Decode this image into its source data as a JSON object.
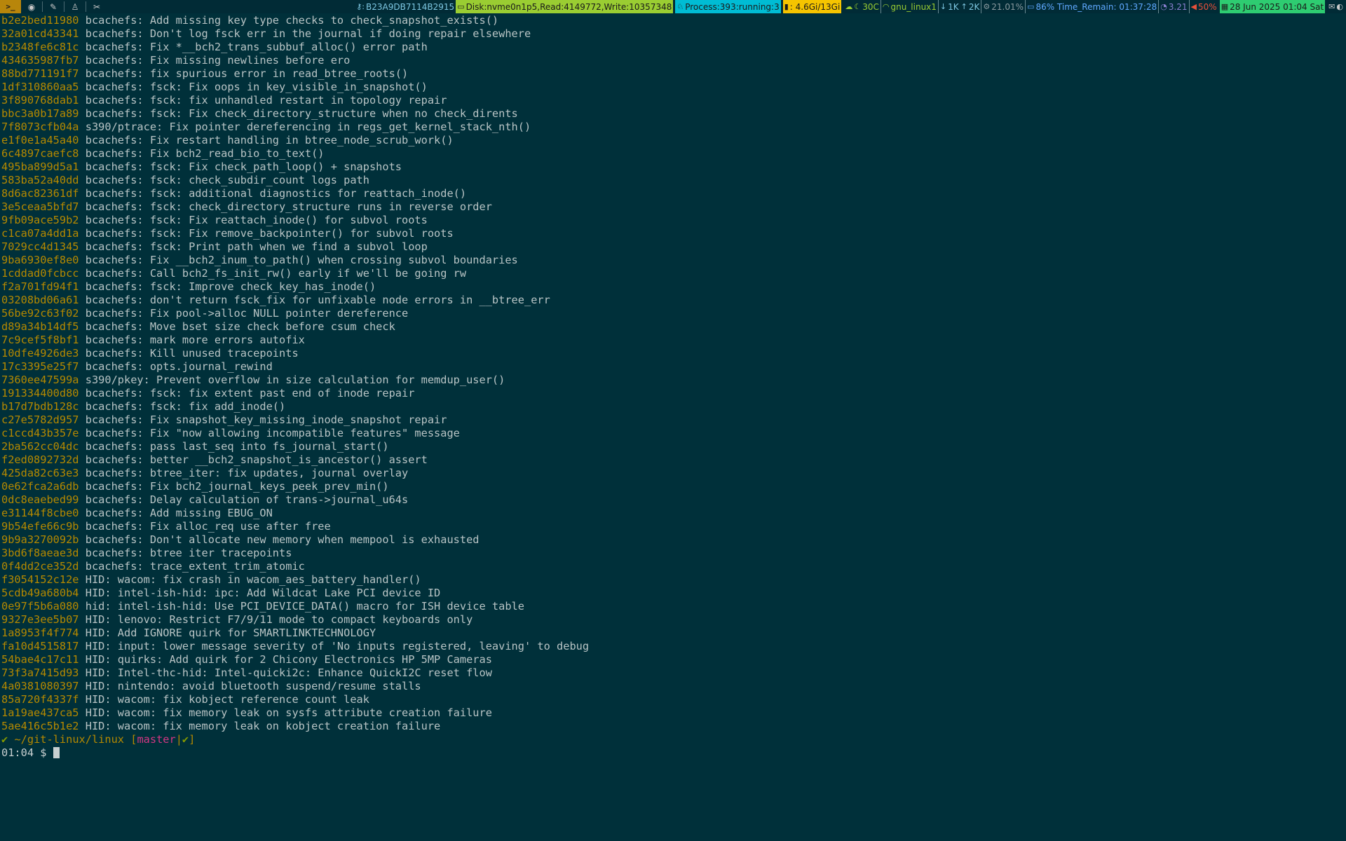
{
  "topbar": {
    "terminal_icon": ">_",
    "key": "B23A9DB7114B2915",
    "disk": "Disk:nvme0n1p5,Read:4149772,Write:10357348",
    "process": "Process:393:running:3",
    "memory": ": 4.6Gi/13Gi",
    "temp": "30C",
    "wifi": "gnu_linux1",
    "down": "1K",
    "up": "2K",
    "cpu": "21.01%",
    "battery": "86% Time_Remain: 01:37:28",
    "load": "3.21",
    "volume": "50%",
    "datetime": "28 Jun 2025 01:04 Sat",
    "colors": {
      "disk_bg": "#9acd32",
      "process_bg": "#00bcd4",
      "memory_bg": "#f5c400",
      "datetime_bg": "#2ecc71"
    }
  },
  "log": [
    {
      "hash": "b2e2bed11980",
      "msg": "bcachefs: Add missing key type checks to check_snapshot_exists()"
    },
    {
      "hash": "32a01cd43341",
      "msg": "bcachefs: Don't log fsck err in the journal if doing repair elsewhere"
    },
    {
      "hash": "b2348fe6c81c",
      "msg": "bcachefs: Fix *__bch2_trans_subbuf_alloc() error path"
    },
    {
      "hash": "434635987fb7",
      "msg": "bcachefs: Fix missing newlines before ero"
    },
    {
      "hash": "88bd771191f7",
      "msg": "bcachefs: fix spurious error in read_btree_roots()"
    },
    {
      "hash": "1df310860aa5",
      "msg": "bcachefs: fsck: Fix oops in key_visible_in_snapshot()"
    },
    {
      "hash": "3f890768dab1",
      "msg": "bcachefs: fsck: fix unhandled restart in topology repair"
    },
    {
      "hash": "bbc3a0b17a89",
      "msg": "bcachefs: fsck: Fix check_directory_structure when no check_dirents"
    },
    {
      "hash": "7f8073cfb04a",
      "msg": "s390/ptrace: Fix pointer dereferencing in regs_get_kernel_stack_nth()"
    },
    {
      "hash": "e1f0e1a45a40",
      "msg": "bcachefs: Fix restart handling in btree_node_scrub_work()"
    },
    {
      "hash": "6c4897caefc8",
      "msg": "bcachefs: Fix bch2_read_bio_to_text()"
    },
    {
      "hash": "495ba899d5a1",
      "msg": "bcachefs: fsck: Fix check_path_loop() + snapshots"
    },
    {
      "hash": "583ba52a40dd",
      "msg": "bcachefs: fsck: check_subdir_count logs path"
    },
    {
      "hash": "8d6ac82361df",
      "msg": "bcachefs: fsck: additional diagnostics for reattach_inode()"
    },
    {
      "hash": "3e5ceaa5bfd7",
      "msg": "bcachefs: fsck: check_directory_structure runs in reverse order"
    },
    {
      "hash": "9fb09ace59b2",
      "msg": "bcachefs: fsck: Fix reattach_inode() for subvol roots"
    },
    {
      "hash": "c1ca07a4dd1a",
      "msg": "bcachefs: fsck: Fix remove_backpointer() for subvol roots"
    },
    {
      "hash": "7029cc4d1345",
      "msg": "bcachefs: fsck: Print path when we find a subvol loop"
    },
    {
      "hash": "9ba6930ef8e0",
      "msg": "bcachefs: Fix __bch2_inum_to_path() when crossing subvol boundaries"
    },
    {
      "hash": "1cddad0fcbcc",
      "msg": "bcachefs: Call bch2_fs_init_rw() early if we'll be going rw"
    },
    {
      "hash": "f2a701fd94f1",
      "msg": "bcachefs: fsck: Improve check_key_has_inode()"
    },
    {
      "hash": "03208bd06a61",
      "msg": "bcachefs: don't return fsck_fix for unfixable node errors in __btree_err"
    },
    {
      "hash": "56be92c63f02",
      "msg": "bcachefs: Fix pool->alloc NULL pointer dereference"
    },
    {
      "hash": "d89a34b14df5",
      "msg": "bcachefs: Move bset size check before csum check"
    },
    {
      "hash": "7c9cef5f8bf1",
      "msg": "bcachefs: mark more errors autofix"
    },
    {
      "hash": "10dfe4926de3",
      "msg": "bcachefs: Kill unused tracepoints"
    },
    {
      "hash": "17c3395e25f7",
      "msg": "bcachefs: opts.journal_rewind"
    },
    {
      "hash": "7360ee47599a",
      "msg": "s390/pkey: Prevent overflow in size calculation for memdup_user()"
    },
    {
      "hash": "191334400d80",
      "msg": "bcachefs: fsck: fix extent past end of inode repair"
    },
    {
      "hash": "b17d7bdb128c",
      "msg": "bcachefs: fsck: fix add_inode()"
    },
    {
      "hash": "c27e5782d957",
      "msg": "bcachefs: Fix snapshot_key_missing_inode_snapshot repair"
    },
    {
      "hash": "c1ccd43b357e",
      "msg": "bcachefs: Fix \"now allowing incompatible features\" message"
    },
    {
      "hash": "2ba562cc04dc",
      "msg": "bcachefs: pass last_seq into fs_journal_start()"
    },
    {
      "hash": "f2ed0892732d",
      "msg": "bcachefs: better __bch2_snapshot_is_ancestor() assert"
    },
    {
      "hash": "425da82c63e3",
      "msg": "bcachefs: btree_iter: fix updates, journal overlay"
    },
    {
      "hash": "0e62fca2a6db",
      "msg": "bcachefs: Fix bch2_journal_keys_peek_prev_min()"
    },
    {
      "hash": "0dc8eaebed99",
      "msg": "bcachefs: Delay calculation of trans->journal_u64s"
    },
    {
      "hash": "e31144f8cbe0",
      "msg": "bcachefs: Add missing EBUG_ON"
    },
    {
      "hash": "9b54efe66c9b",
      "msg": "bcachefs: Fix alloc_req use after free"
    },
    {
      "hash": "9b9a3270092b",
      "msg": "bcachefs: Don't allocate new memory when mempool is exhausted"
    },
    {
      "hash": "3bd6f8aeae3d",
      "msg": "bcachefs: btree iter tracepoints"
    },
    {
      "hash": "0f4dd2ce352d",
      "msg": "bcachefs: trace_extent_trim_atomic"
    },
    {
      "hash": "f3054152c12e",
      "msg": "HID: wacom: fix crash in wacom_aes_battery_handler()"
    },
    {
      "hash": "5cdb49a680b4",
      "msg": "HID: intel-ish-hid: ipc: Add Wildcat Lake PCI device ID"
    },
    {
      "hash": "0e97f5b6a080",
      "msg": "hid: intel-ish-hid: Use PCI_DEVICE_DATA() macro for ISH device table"
    },
    {
      "hash": "9327e3ee5b07",
      "msg": "HID: lenovo: Restrict F7/9/11 mode to compact keyboards only"
    },
    {
      "hash": "1a8953f4f774",
      "msg": "HID: Add IGNORE quirk for SMARTLINKTECHNOLOGY"
    },
    {
      "hash": "fa10d4515817",
      "msg": "HID: input: lower message severity of 'No inputs registered, leaving' to debug"
    },
    {
      "hash": "54bae4c17c11",
      "msg": "HID: quirks: Add quirk for 2 Chicony Electronics HP 5MP Cameras"
    },
    {
      "hash": "73f3a7415d93",
      "msg": "HID: Intel-thc-hid: Intel-quicki2c: Enhance QuickI2C reset flow"
    },
    {
      "hash": "4a0381080397",
      "msg": "HID: nintendo: avoid bluetooth suspend/resume stalls"
    },
    {
      "hash": "85a720f4337f",
      "msg": "HID: wacom: fix kobject reference count leak"
    },
    {
      "hash": "1a19ae437ca5",
      "msg": "HID: wacom: fix memory leak on sysfs attribute creation failure"
    },
    {
      "hash": "5ae416c5b1e2",
      "msg": "HID: wacom: fix memory leak on kobject creation failure"
    }
  ],
  "prompt": {
    "check": "✔",
    "path": "~/git-linux/linux",
    "branch": "master",
    "status": "✔",
    "time": "01:04",
    "symbol": "$"
  }
}
